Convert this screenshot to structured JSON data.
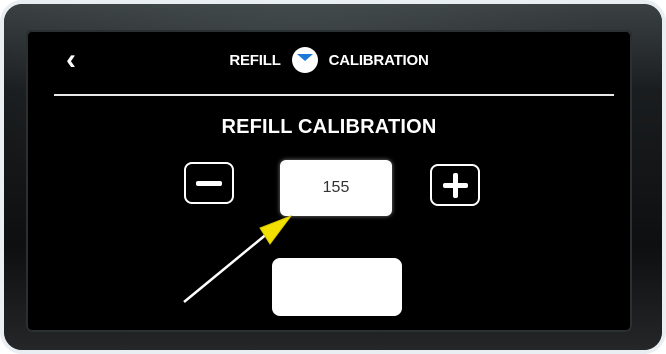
{
  "header": {
    "back_icon": "chevron-left-icon",
    "title_left": "REFILL",
    "logo_icon": "brand-logo-icon",
    "title_right": "CALIBRATION"
  },
  "main": {
    "title": "REFILL CALIBRATION",
    "decrement_icon": "minus-icon",
    "value": "155",
    "increment_icon": "plus-icon",
    "confirm_label": ""
  },
  "annotation": {
    "pointer_icon": "cursor-arrow-icon",
    "pointer_color": "#f2e100",
    "arrow_line_color": "#ffffff"
  },
  "colors": {
    "screen_bg": "#000000",
    "text": "#ffffff",
    "logo_blue": "#1e78d7"
  }
}
